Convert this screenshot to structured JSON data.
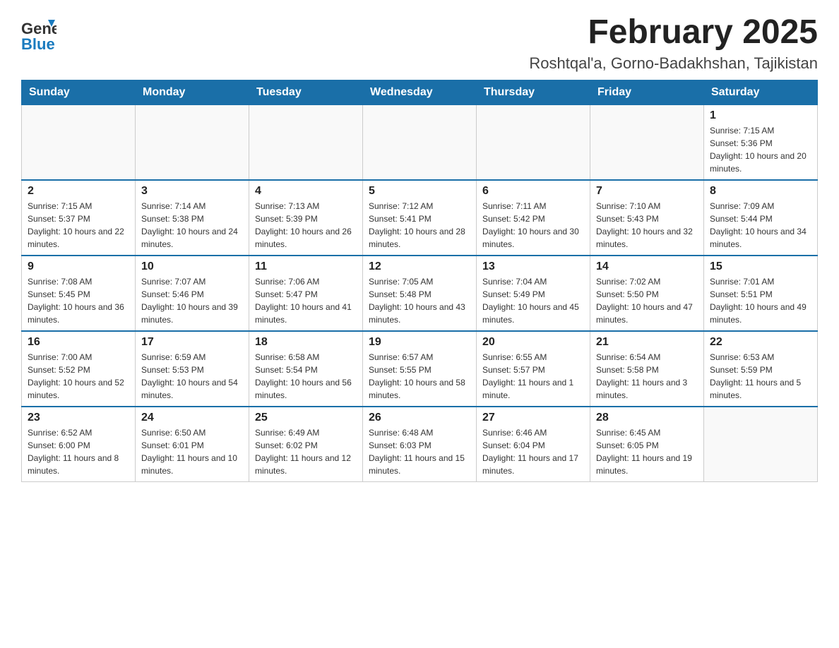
{
  "header": {
    "logo": {
      "general": "General",
      "blue": "Blue"
    },
    "title": "February 2025",
    "subtitle": "Roshtqal'a, Gorno-Badakhshan, Tajikistan"
  },
  "calendar": {
    "days_of_week": [
      "Sunday",
      "Monday",
      "Tuesday",
      "Wednesday",
      "Thursday",
      "Friday",
      "Saturday"
    ],
    "weeks": [
      [
        {
          "day": "",
          "info": ""
        },
        {
          "day": "",
          "info": ""
        },
        {
          "day": "",
          "info": ""
        },
        {
          "day": "",
          "info": ""
        },
        {
          "day": "",
          "info": ""
        },
        {
          "day": "",
          "info": ""
        },
        {
          "day": "1",
          "info": "Sunrise: 7:15 AM\nSunset: 5:36 PM\nDaylight: 10 hours and 20 minutes."
        }
      ],
      [
        {
          "day": "2",
          "info": "Sunrise: 7:15 AM\nSunset: 5:37 PM\nDaylight: 10 hours and 22 minutes."
        },
        {
          "day": "3",
          "info": "Sunrise: 7:14 AM\nSunset: 5:38 PM\nDaylight: 10 hours and 24 minutes."
        },
        {
          "day": "4",
          "info": "Sunrise: 7:13 AM\nSunset: 5:39 PM\nDaylight: 10 hours and 26 minutes."
        },
        {
          "day": "5",
          "info": "Sunrise: 7:12 AM\nSunset: 5:41 PM\nDaylight: 10 hours and 28 minutes."
        },
        {
          "day": "6",
          "info": "Sunrise: 7:11 AM\nSunset: 5:42 PM\nDaylight: 10 hours and 30 minutes."
        },
        {
          "day": "7",
          "info": "Sunrise: 7:10 AM\nSunset: 5:43 PM\nDaylight: 10 hours and 32 minutes."
        },
        {
          "day": "8",
          "info": "Sunrise: 7:09 AM\nSunset: 5:44 PM\nDaylight: 10 hours and 34 minutes."
        }
      ],
      [
        {
          "day": "9",
          "info": "Sunrise: 7:08 AM\nSunset: 5:45 PM\nDaylight: 10 hours and 36 minutes."
        },
        {
          "day": "10",
          "info": "Sunrise: 7:07 AM\nSunset: 5:46 PM\nDaylight: 10 hours and 39 minutes."
        },
        {
          "day": "11",
          "info": "Sunrise: 7:06 AM\nSunset: 5:47 PM\nDaylight: 10 hours and 41 minutes."
        },
        {
          "day": "12",
          "info": "Sunrise: 7:05 AM\nSunset: 5:48 PM\nDaylight: 10 hours and 43 minutes."
        },
        {
          "day": "13",
          "info": "Sunrise: 7:04 AM\nSunset: 5:49 PM\nDaylight: 10 hours and 45 minutes."
        },
        {
          "day": "14",
          "info": "Sunrise: 7:02 AM\nSunset: 5:50 PM\nDaylight: 10 hours and 47 minutes."
        },
        {
          "day": "15",
          "info": "Sunrise: 7:01 AM\nSunset: 5:51 PM\nDaylight: 10 hours and 49 minutes."
        }
      ],
      [
        {
          "day": "16",
          "info": "Sunrise: 7:00 AM\nSunset: 5:52 PM\nDaylight: 10 hours and 52 minutes."
        },
        {
          "day": "17",
          "info": "Sunrise: 6:59 AM\nSunset: 5:53 PM\nDaylight: 10 hours and 54 minutes."
        },
        {
          "day": "18",
          "info": "Sunrise: 6:58 AM\nSunset: 5:54 PM\nDaylight: 10 hours and 56 minutes."
        },
        {
          "day": "19",
          "info": "Sunrise: 6:57 AM\nSunset: 5:55 PM\nDaylight: 10 hours and 58 minutes."
        },
        {
          "day": "20",
          "info": "Sunrise: 6:55 AM\nSunset: 5:57 PM\nDaylight: 11 hours and 1 minute."
        },
        {
          "day": "21",
          "info": "Sunrise: 6:54 AM\nSunset: 5:58 PM\nDaylight: 11 hours and 3 minutes."
        },
        {
          "day": "22",
          "info": "Sunrise: 6:53 AM\nSunset: 5:59 PM\nDaylight: 11 hours and 5 minutes."
        }
      ],
      [
        {
          "day": "23",
          "info": "Sunrise: 6:52 AM\nSunset: 6:00 PM\nDaylight: 11 hours and 8 minutes."
        },
        {
          "day": "24",
          "info": "Sunrise: 6:50 AM\nSunset: 6:01 PM\nDaylight: 11 hours and 10 minutes."
        },
        {
          "day": "25",
          "info": "Sunrise: 6:49 AM\nSunset: 6:02 PM\nDaylight: 11 hours and 12 minutes."
        },
        {
          "day": "26",
          "info": "Sunrise: 6:48 AM\nSunset: 6:03 PM\nDaylight: 11 hours and 15 minutes."
        },
        {
          "day": "27",
          "info": "Sunrise: 6:46 AM\nSunset: 6:04 PM\nDaylight: 11 hours and 17 minutes."
        },
        {
          "day": "28",
          "info": "Sunrise: 6:45 AM\nSunset: 6:05 PM\nDaylight: 11 hours and 19 minutes."
        },
        {
          "day": "",
          "info": ""
        }
      ]
    ]
  }
}
